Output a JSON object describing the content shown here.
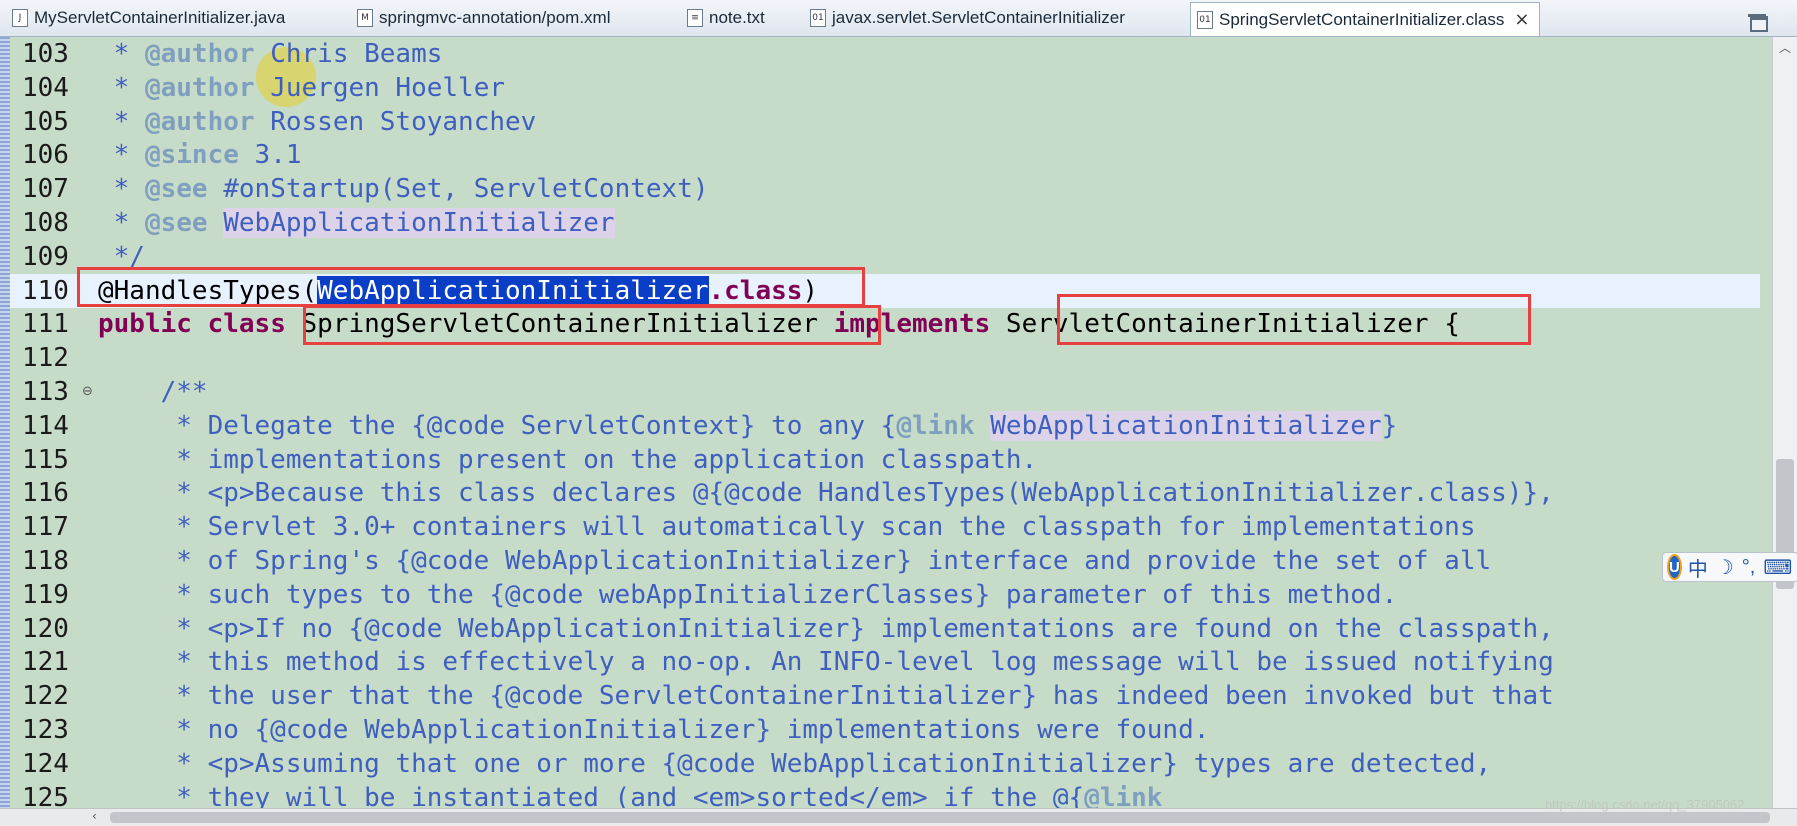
{
  "tabs": [
    {
      "label": "MyServletContainerInitializer.java",
      "icon": "java-file-icon",
      "active": false
    },
    {
      "label": "springmvc-annotation/pom.xml",
      "icon": "maven-pom-icon",
      "active": false
    },
    {
      "label": "note.txt",
      "icon": "text-file-icon",
      "active": false
    },
    {
      "label": "javax.servlet.ServletContainerInitializer",
      "icon": "class-file-icon",
      "active": false
    },
    {
      "label": "SpringServletContainerInitializer.class",
      "icon": "class-file-icon",
      "active": true
    }
  ],
  "tab_close": "×",
  "editor": {
    "lines": [
      {
        "num": "103",
        "segs": [
          {
            "t": " * "
          },
          {
            "t": "@author",
            "c": "tag"
          },
          {
            "t": " Chris Beams"
          }
        ]
      },
      {
        "num": "104",
        "segs": [
          {
            "t": " * "
          },
          {
            "t": "@author",
            "c": "tag"
          },
          {
            "t": " Juergen Hoeller"
          }
        ]
      },
      {
        "num": "105",
        "segs": [
          {
            "t": " * "
          },
          {
            "t": "@author",
            "c": "tag"
          },
          {
            "t": " Rossen Stoyanchev"
          }
        ]
      },
      {
        "num": "106",
        "segs": [
          {
            "t": " * "
          },
          {
            "t": "@since",
            "c": "tag"
          },
          {
            "t": " 3.1"
          }
        ]
      },
      {
        "num": "107",
        "segs": [
          {
            "t": " * "
          },
          {
            "t": "@see",
            "c": "tag"
          },
          {
            "t": " #onStartup(Set, ServletContext)"
          }
        ]
      },
      {
        "num": "108",
        "segs": [
          {
            "t": " * "
          },
          {
            "t": "@see",
            "c": "tag"
          },
          {
            "t": " "
          },
          {
            "t": "WebApplicationInitializer",
            "c": "ref"
          }
        ]
      },
      {
        "num": "109",
        "segs": [
          {
            "t": " */"
          }
        ]
      },
      {
        "num": "110",
        "current": true,
        "segs": [
          {
            "t": "@HandlesTypes(",
            "c": "plain"
          },
          {
            "t": "WebApplicationInitializer",
            "c": "sel"
          },
          {
            "t": ".class",
            "c": "kw"
          },
          {
            "t": ")",
            "c": "plain"
          }
        ]
      },
      {
        "num": "111",
        "segs": [
          {
            "t": "public",
            "c": "kw"
          },
          {
            "t": " ",
            "c": "plain"
          },
          {
            "t": "class",
            "c": "kw"
          },
          {
            "t": " SpringServletContainerInitializer ",
            "c": "plain"
          },
          {
            "t": "implements",
            "c": "kw"
          },
          {
            "t": " ServletContainerInitializer {",
            "c": "plain"
          }
        ]
      },
      {
        "num": "112",
        "segs": []
      },
      {
        "num": "113",
        "fold": "⊖",
        "segs": [
          {
            "t": "    /**"
          }
        ]
      },
      {
        "num": "114",
        "segs": [
          {
            "t": "     * Delegate the {@code ServletContext} to any {"
          },
          {
            "t": "@link",
            "c": "tag"
          },
          {
            "t": " "
          },
          {
            "t": "WebApplicationInitializer",
            "c": "ref"
          },
          {
            "t": "}"
          }
        ]
      },
      {
        "num": "115",
        "segs": [
          {
            "t": "     * implementations present on the application classpath."
          }
        ]
      },
      {
        "num": "116",
        "segs": [
          {
            "t": "     * <p>Because this class declares @{@code HandlesTypes(WebApplicationInitializer.class)},"
          }
        ]
      },
      {
        "num": "117",
        "segs": [
          {
            "t": "     * Servlet 3.0+ containers will automatically scan the classpath for implementations"
          }
        ]
      },
      {
        "num": "118",
        "segs": [
          {
            "t": "     * of Spring's {@code WebApplicationInitializer} interface and provide the set of all"
          }
        ]
      },
      {
        "num": "119",
        "segs": [
          {
            "t": "     * such types to the {@code webAppInitializerClasses} parameter of this method."
          }
        ]
      },
      {
        "num": "120",
        "segs": [
          {
            "t": "     * <p>If no {@code WebApplicationInitializer} implementations are found on the classpath,"
          }
        ]
      },
      {
        "num": "121",
        "segs": [
          {
            "t": "     * this method is effectively a no-op. An INFO-level log message will be issued notifying"
          }
        ]
      },
      {
        "num": "122",
        "segs": [
          {
            "t": "     * the user that the {@code ServletContainerInitializer} has indeed been invoked but that"
          }
        ]
      },
      {
        "num": "123",
        "segs": [
          {
            "t": "     * no {@code WebApplicationInitializer} implementations were found."
          }
        ]
      },
      {
        "num": "124",
        "segs": [
          {
            "t": "     * <p>Assuming that one or more {@code WebApplicationInitializer} types are detected,"
          }
        ]
      },
      {
        "num": "125",
        "segs": [
          {
            "t": "     * they will be instantiated (and <em>sorted</em> if the @{"
          },
          {
            "t": "@link",
            "c": "tag"
          }
        ]
      }
    ]
  },
  "ime": {
    "lang": "中",
    "mode": "☽",
    "punct": "°,",
    "kbd": "⌨"
  },
  "watermark": "https://blog.csdn.net/qq_37905062"
}
